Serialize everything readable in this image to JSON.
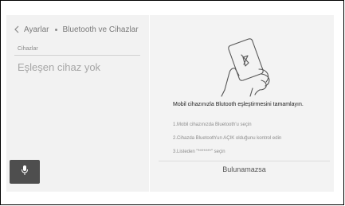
{
  "breadcrumb": {
    "items": [
      "Ayarlar",
      "Bluetooth ve Cihazlar"
    ]
  },
  "devices_section": {
    "label": "Cihazlar",
    "empty_text": "Eşleşen cihaz yok"
  },
  "pairing": {
    "prompt": "Mobil cihazınızla Blutooth eşleştirmesini tamamlayın.",
    "steps": [
      "1.Mobil cihazınızda Bluetooth'u seçin",
      "2.Cihazda Bluetooth'un AÇIK olduğunu kontrol edin",
      "3.Listeden \"*******\" seçin"
    ],
    "not_found_button": "Bulunamazsa"
  },
  "icons": {
    "back": "chevron-left-icon",
    "mic": "microphone-icon",
    "illustration": "hand-holding-phone-bluetooth-icon"
  }
}
